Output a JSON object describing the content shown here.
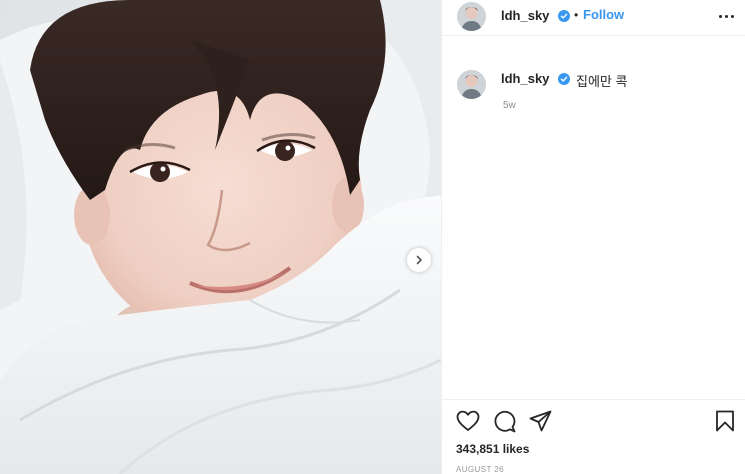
{
  "post": {
    "username": "ldh_sky",
    "verified": true,
    "separator": "•",
    "follow_label": "Follow",
    "caption": "집에만 콕",
    "time_ago": "5w",
    "likes": "343,851 likes",
    "date": "AUGUST 26"
  },
  "icons": {
    "more": "more-options-icon",
    "like": "heart-icon",
    "comment": "comment-icon",
    "share": "share-icon",
    "save": "bookmark-icon",
    "next": "chevron-right-icon",
    "verified": "verified-badge-icon"
  },
  "colors": {
    "accent": "#3897f0",
    "text": "#262626",
    "muted": "#8e8e8e",
    "border": "#efefef"
  }
}
